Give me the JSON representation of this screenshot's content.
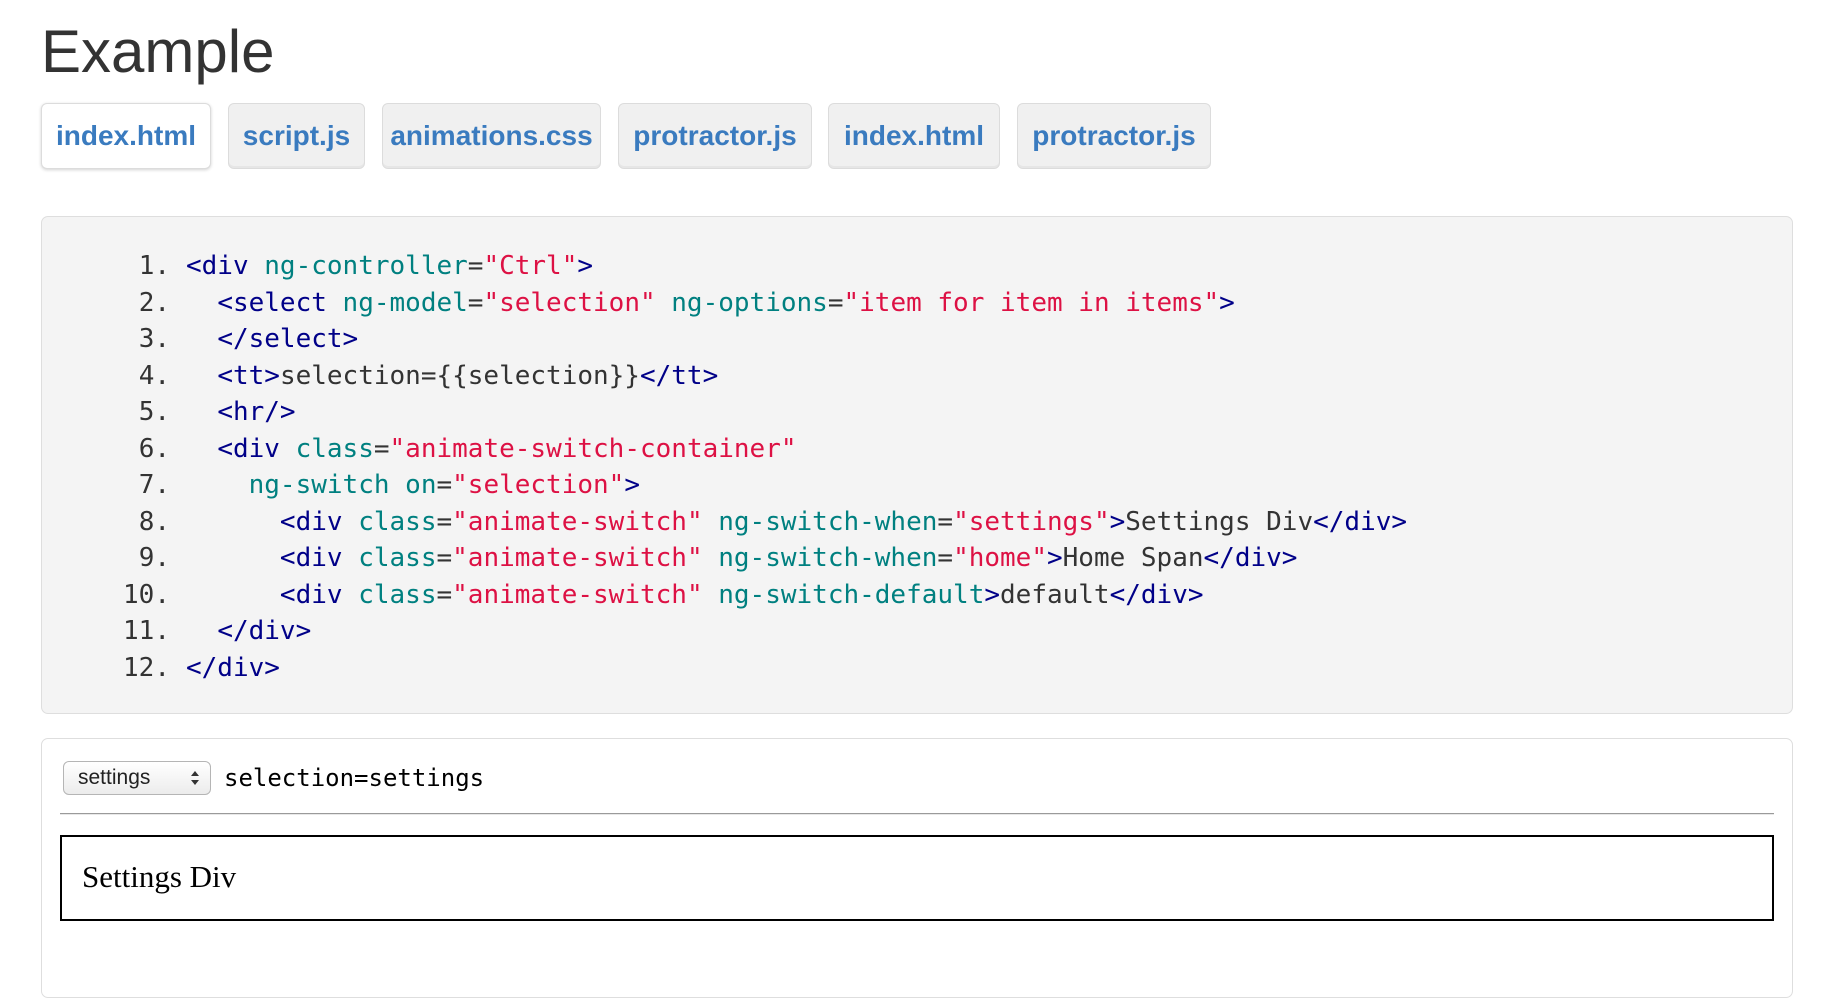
{
  "page": {
    "title": "Example"
  },
  "tabs": [
    {
      "label": "index.html",
      "active": true
    },
    {
      "label": "script.js",
      "active": false
    },
    {
      "label": "animations.css",
      "active": false
    },
    {
      "label": "protractor.js",
      "active": false
    },
    {
      "label": "index.html",
      "active": false
    },
    {
      "label": "protractor.js",
      "active": false
    }
  ],
  "code": {
    "lines": [
      {
        "no": "1.",
        "indent": "",
        "tokens": [
          [
            "tag",
            "<div"
          ],
          [
            "pln",
            " "
          ],
          [
            "atn",
            "ng-controller"
          ],
          [
            "pln",
            "="
          ],
          [
            "atv",
            "\"Ctrl\""
          ],
          [
            "tag",
            ">"
          ]
        ]
      },
      {
        "no": "2.",
        "indent": "  ",
        "tokens": [
          [
            "tag",
            "<select"
          ],
          [
            "pln",
            " "
          ],
          [
            "atn",
            "ng-model"
          ],
          [
            "pln",
            "="
          ],
          [
            "atv",
            "\"selection\""
          ],
          [
            "pln",
            " "
          ],
          [
            "atn",
            "ng-options"
          ],
          [
            "pln",
            "="
          ],
          [
            "atv",
            "\"item for item in items\""
          ],
          [
            "tag",
            ">"
          ]
        ]
      },
      {
        "no": "3.",
        "indent": "  ",
        "tokens": [
          [
            "tag",
            "</select>"
          ]
        ]
      },
      {
        "no": "4.",
        "indent": "  ",
        "tokens": [
          [
            "tag",
            "<tt>"
          ],
          [
            "pln",
            "selection={{selection}}"
          ],
          [
            "tag",
            "</tt>"
          ]
        ]
      },
      {
        "no": "5.",
        "indent": "  ",
        "tokens": [
          [
            "tag",
            "<hr/>"
          ]
        ]
      },
      {
        "no": "6.",
        "indent": "  ",
        "tokens": [
          [
            "tag",
            "<div"
          ],
          [
            "pln",
            " "
          ],
          [
            "atn",
            "class"
          ],
          [
            "pln",
            "="
          ],
          [
            "atv",
            "\"animate-switch-container\""
          ]
        ]
      },
      {
        "no": "7.",
        "indent": "    ",
        "tokens": [
          [
            "atn",
            "ng-switch"
          ],
          [
            "pln",
            " "
          ],
          [
            "atn",
            "on"
          ],
          [
            "pln",
            "="
          ],
          [
            "atv",
            "\"selection\""
          ],
          [
            "tag",
            ">"
          ]
        ]
      },
      {
        "no": "8.",
        "indent": "      ",
        "tokens": [
          [
            "tag",
            "<div"
          ],
          [
            "pln",
            " "
          ],
          [
            "atn",
            "class"
          ],
          [
            "pln",
            "="
          ],
          [
            "atv",
            "\"animate-switch\""
          ],
          [
            "pln",
            " "
          ],
          [
            "atn",
            "ng-switch-when"
          ],
          [
            "pln",
            "="
          ],
          [
            "atv",
            "\"settings\""
          ],
          [
            "tag",
            ">"
          ],
          [
            "pln",
            "Settings Div"
          ],
          [
            "tag",
            "</div>"
          ]
        ]
      },
      {
        "no": "9.",
        "indent": "      ",
        "tokens": [
          [
            "tag",
            "<div"
          ],
          [
            "pln",
            " "
          ],
          [
            "atn",
            "class"
          ],
          [
            "pln",
            "="
          ],
          [
            "atv",
            "\"animate-switch\""
          ],
          [
            "pln",
            " "
          ],
          [
            "atn",
            "ng-switch-when"
          ],
          [
            "pln",
            "="
          ],
          [
            "atv",
            "\"home\""
          ],
          [
            "tag",
            ">"
          ],
          [
            "pln",
            "Home Span"
          ],
          [
            "tag",
            "</div>"
          ]
        ]
      },
      {
        "no": "10.",
        "indent": "      ",
        "tokens": [
          [
            "tag",
            "<div"
          ],
          [
            "pln",
            " "
          ],
          [
            "atn",
            "class"
          ],
          [
            "pln",
            "="
          ],
          [
            "atv",
            "\"animate-switch\""
          ],
          [
            "pln",
            " "
          ],
          [
            "atn",
            "ng-switch-default"
          ],
          [
            "tag",
            ">"
          ],
          [
            "pln",
            "default"
          ],
          [
            "tag",
            "</div>"
          ]
        ]
      },
      {
        "no": "11.",
        "indent": "  ",
        "tokens": [
          [
            "tag",
            "</div>"
          ]
        ]
      },
      {
        "no": "12.",
        "indent": "",
        "tokens": [
          [
            "tag",
            "</div>"
          ]
        ]
      }
    ]
  },
  "demo": {
    "select_value": "settings",
    "select_icon": "up-down-arrows-icon",
    "selection_text": "selection=settings",
    "switch_content": "Settings Div"
  }
}
